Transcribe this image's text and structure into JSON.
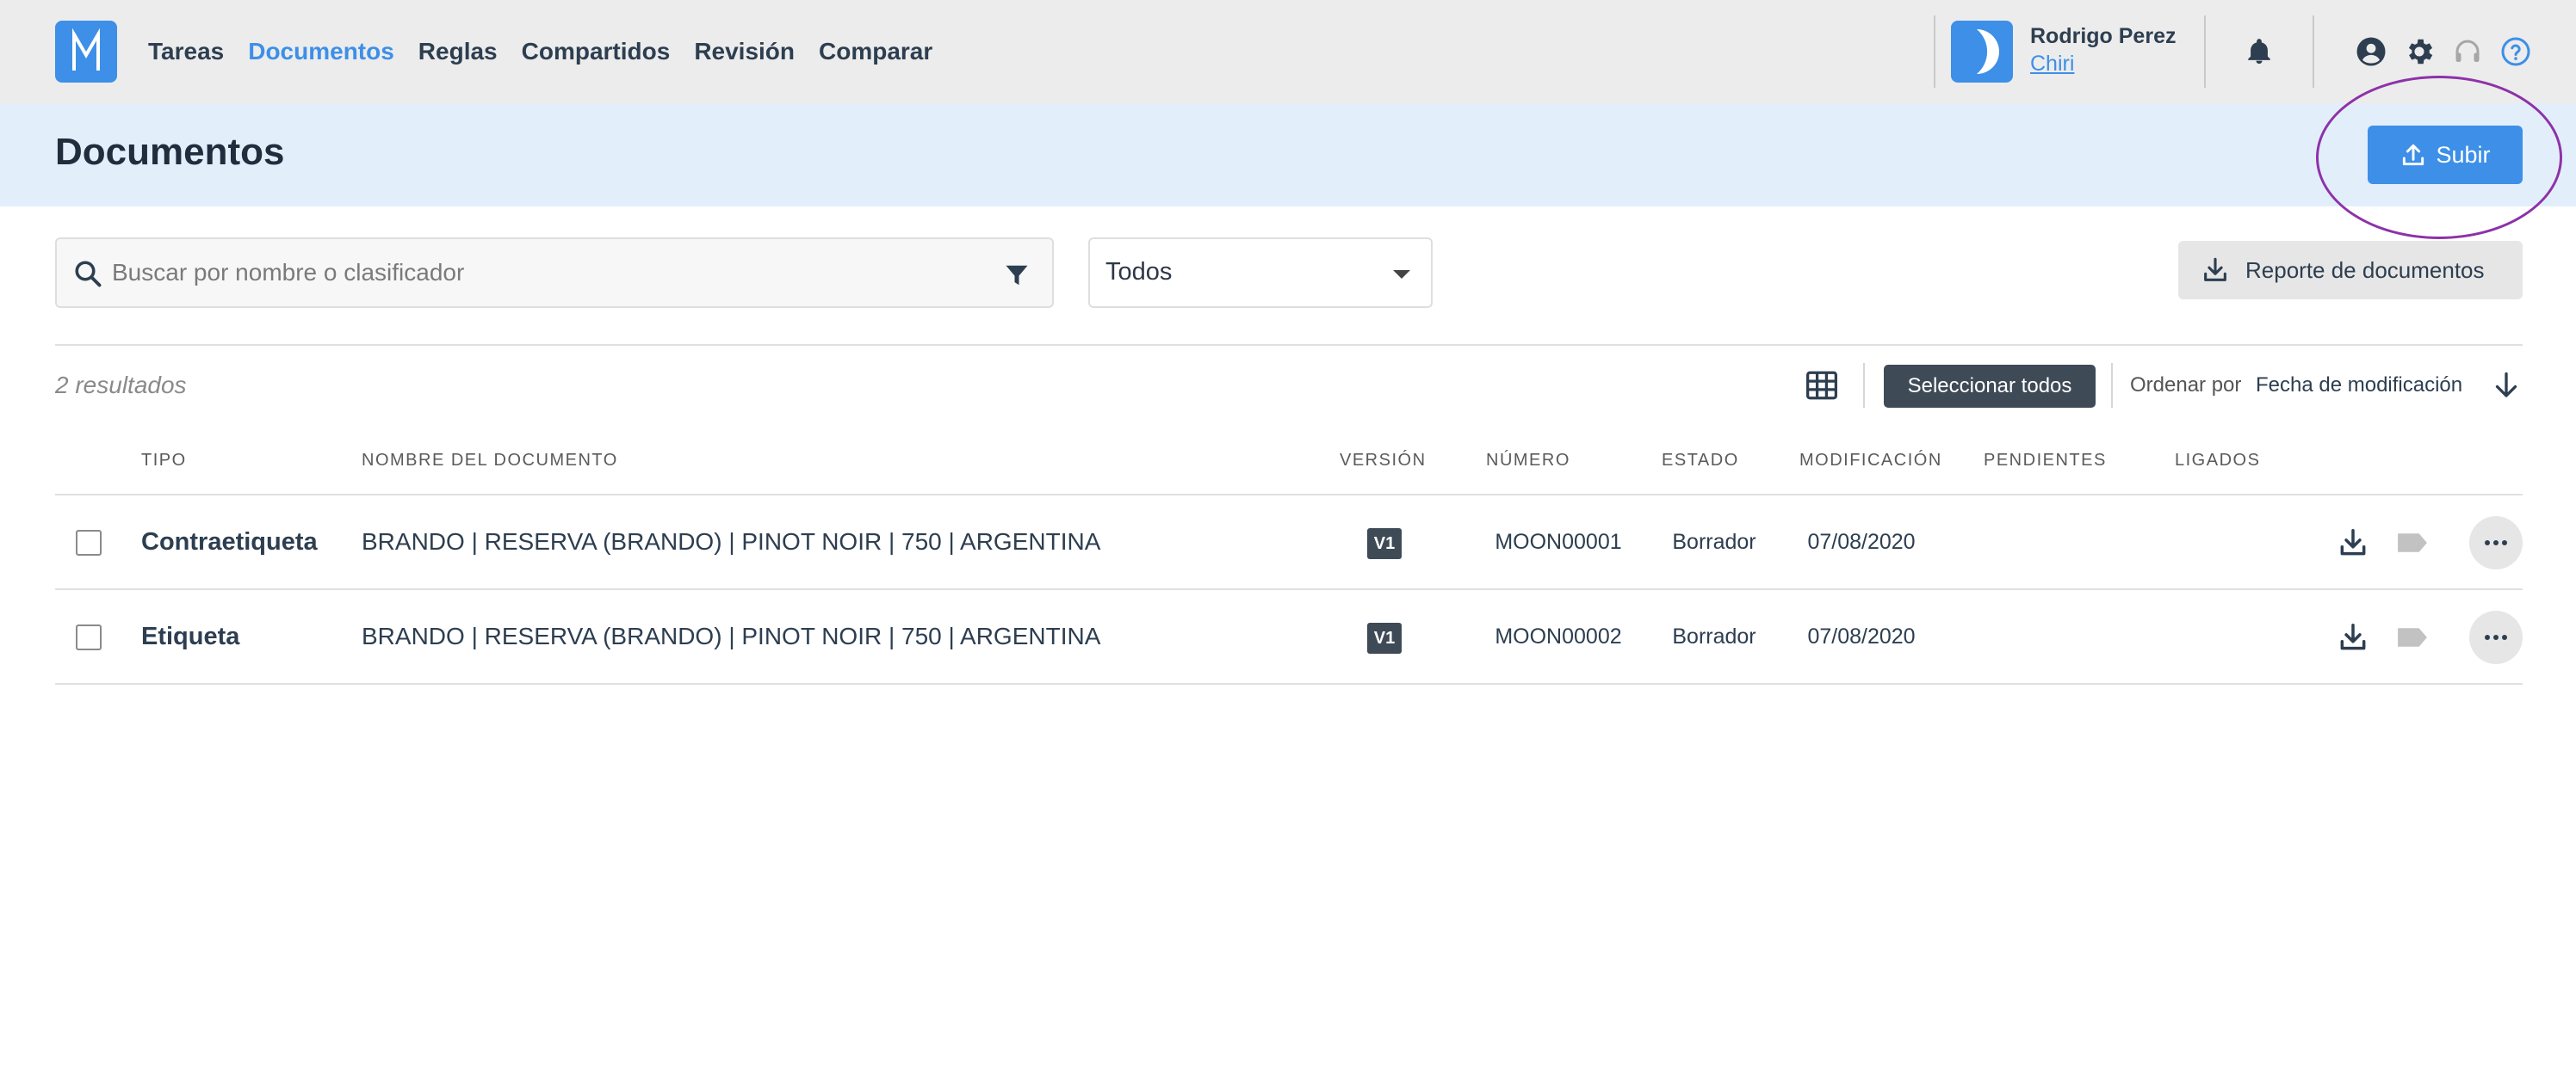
{
  "nav": {
    "items": [
      {
        "label": "Tareas",
        "active": false
      },
      {
        "label": "Documentos",
        "active": true
      },
      {
        "label": "Reglas",
        "active": false
      },
      {
        "label": "Compartidos",
        "active": false
      },
      {
        "label": "Revisión",
        "active": false
      },
      {
        "label": "Comparar",
        "active": false
      }
    ],
    "logo_icon": "m-logo-icon"
  },
  "user": {
    "name": "Rodrigo Perez",
    "org": "Chiri",
    "avatar_icon": "moon-icon"
  },
  "top_icons": [
    "bell-icon",
    "user-circle-icon",
    "gear-icon",
    "headset-icon",
    "help-circle-icon"
  ],
  "header": {
    "title": "Documentos",
    "upload_label": "Subir"
  },
  "search": {
    "placeholder": "Buscar por nombre o clasificador",
    "value": ""
  },
  "filter_select": {
    "selected": "Todos"
  },
  "report_button": {
    "label": "Reporte de documentos"
  },
  "toolbar": {
    "results": "2 resultados",
    "select_all": "Seleccionar todos",
    "sort_label": "Ordenar por",
    "sort_value": "Fecha de modificación"
  },
  "table": {
    "columns": [
      "TIPO",
      "NOMBRE DEL DOCUMENTO",
      "VERSIÓN",
      "NÚMERO",
      "ESTADO",
      "MODIFICACIÓN",
      "PENDIENTES",
      "LIGADOS"
    ],
    "rows": [
      {
        "type": "Contraetiqueta",
        "name": "BRANDO | RESERVA (BRANDO) | PINOT NOIR | 750 | ARGENTINA",
        "version": "V1",
        "number": "MOON00001",
        "state": "Borrador",
        "modified": "07/08/2020",
        "pending": "",
        "linked": ""
      },
      {
        "type": "Etiqueta",
        "name": "BRANDO | RESERVA (BRANDO) | PINOT NOIR | 750 | ARGENTINA",
        "version": "V1",
        "number": "MOON00002",
        "state": "Borrador",
        "modified": "07/08/2020",
        "pending": "",
        "linked": ""
      }
    ]
  },
  "colors": {
    "accent": "#3d8fe8",
    "header_band": "#e3eefb",
    "topbar": "#ececec",
    "dark_badge": "#3f4a57",
    "highlight_ring": "#8d32a8"
  }
}
